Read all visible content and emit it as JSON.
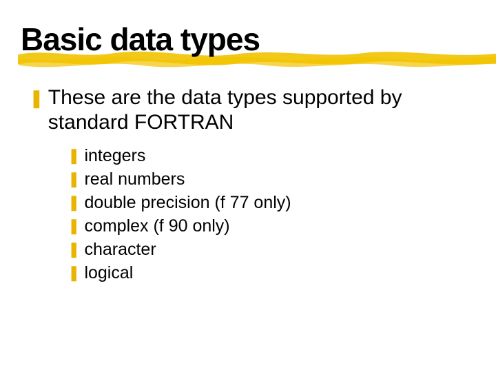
{
  "title": "Basic data types",
  "lead_bullet_glyph": "❚",
  "lead_text": "These are the data types supported by standard FORTRAN",
  "sub_bullet_glyph": "❚",
  "items": [
    "integers",
    "real numbers",
    "double precision (f 77 only)",
    "complex (f 90 only)",
    "character",
    "logical"
  ]
}
